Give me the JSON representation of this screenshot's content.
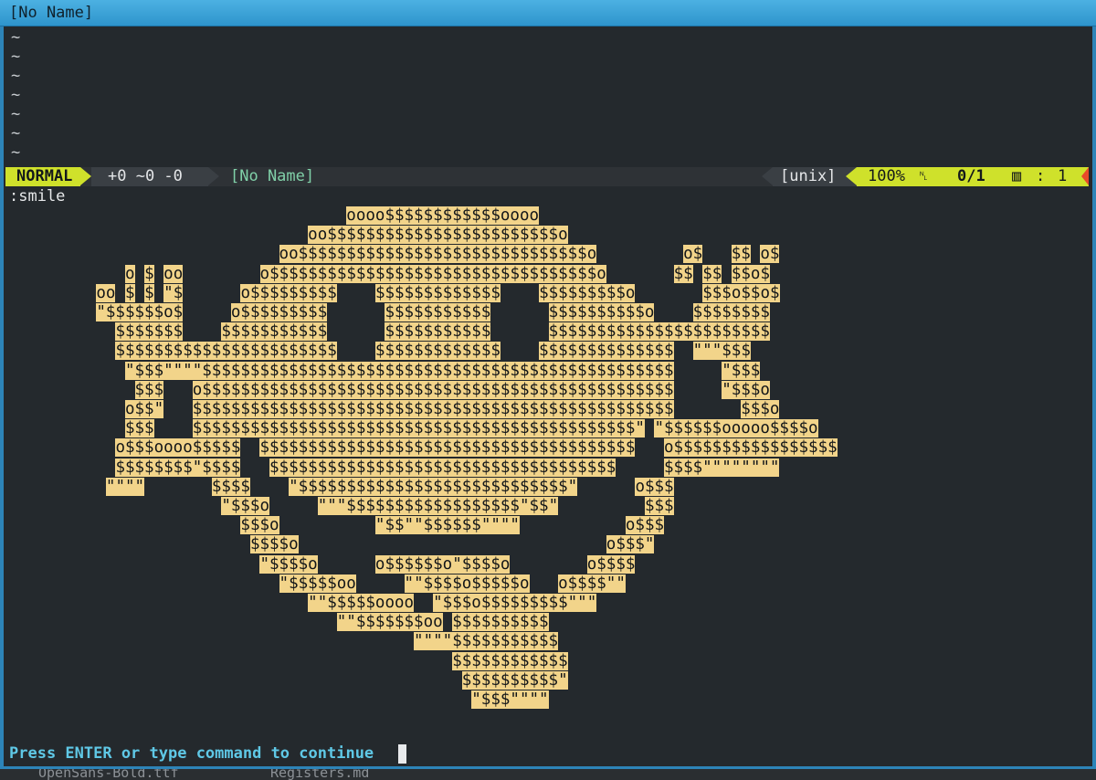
{
  "window": {
    "title": "[No Name]"
  },
  "editor": {
    "tildes": [
      "~",
      "~",
      "~",
      "~",
      "~",
      "~",
      "~"
    ],
    "command": ":smile",
    "prompt": "Press ENTER or type command to continue"
  },
  "statusline": {
    "mode": "NORMAL",
    "git": "+0 ~0 -0",
    "filename": "[No Name]",
    "fileformat": "[unix]",
    "percent": "100%",
    "line_icon": "ln-icon",
    "position": "0/1",
    "column_icon": "column-icon",
    "separator": ":",
    "column": "1",
    "colors": {
      "mode_bg": "#cfe12b",
      "bar_bg": "#2e3236",
      "segment_bg": "#3a3f44",
      "filename_fg": "#80d0a8",
      "warning_marker": "#e84a2a"
    }
  },
  "smile_art": [
    "                                    oooo$$$$$$$$$$$$oooo",
    "                                oo$$$$$$$$$$$$$$$$$$$$$$$$o",
    "                             oo$$$$$$$$$$$$$$$$$$$$$$$$$$$$$$o         o$   $$ o$",
    "             o $ oo        o$$$$$$$$$$$$$$$$$$$$$$$$$$$$$$$$$$o       $$ $$ $$o$",
    "          oo $ $ \"$      o$$$$$$$$$    $$$$$$$$$$$$$    $$$$$$$$$o       $$$o$$o$",
    "          \"$$$$$$o$     o$$$$$$$$$      $$$$$$$$$$$      $$$$$$$$$$o    $$$$$$$$",
    "            $$$$$$$    $$$$$$$$$$$      $$$$$$$$$$$      $$$$$$$$$$$$$$$$$$$$$$$",
    "            $$$$$$$$$$$$$$$$$$$$$$$    $$$$$$$$$$$$$    $$$$$$$$$$$$$$  \"\"\"$$$",
    "             \"$$$\"\"\"\"$$$$$$$$$$$$$$$$$$$$$$$$$$$$$$$$$$$$$$$$$$$$$$$$$     \"$$$",
    "              $$$   o$$$$$$$$$$$$$$$$$$$$$$$$$$$$$$$$$$$$$$$$$$$$$$$$$     \"$$$o",
    "             o$$\"   $$$$$$$$$$$$$$$$$$$$$$$$$$$$$$$$$$$$$$$$$$$$$$$$$$       $$$o",
    "             $$$    $$$$$$$$$$$$$$$$$$$$$$$$$$$$$$$$$$$$$$$$$$$$$$\" \"$$$$$$ooooo$$$$o",
    "            o$$$oooo$$$$$  $$$$$$$$$$$$$$$$$$$$$$$$$$$$$$$$$$$$$$$   o$$$$$$$$$$$$$$$$$",
    "            $$$$$$$$\"$$$$   $$$$$$$$$$$$$$$$$$$$$$$$$$$$$$$$$$$$     $$$$\"\"\"\"\"\"\"\"",
    "           \"\"\"\"       $$$$    \"$$$$$$$$$$$$$$$$$$$$$$$$$$$$\"      o$$$",
    "                       \"$$$o     \"\"\"$$$$$$$$$$$$$$$$$$\"$$\"         $$$",
    "                         $$$o          \"$$\"\"$$$$$$\"\"\"\"           o$$$",
    "                          $$$$o                                o$$$\"",
    "                           \"$$$$o      o$$$$$$o\"$$$$o        o$$$$",
    "                             \"$$$$$oo     \"\"$$$$o$$$$$o   o$$$$\"\"",
    "                                \"\"$$$$$oooo  \"$$$o$$$$$$$$$\"\"\"",
    "                                   \"\"$$$$$$$oo $$$$$$$$$$",
    "                                           \"\"\"\"$$$$$$$$$$$",
    "                                               $$$$$$$$$$$$",
    "                                                $$$$$$$$$$\"",
    "                                                 \"$$$\"\"\"\""
  ],
  "background_files": [
    "OpenSans-Bold.ttf",
    "Registers.md"
  ]
}
